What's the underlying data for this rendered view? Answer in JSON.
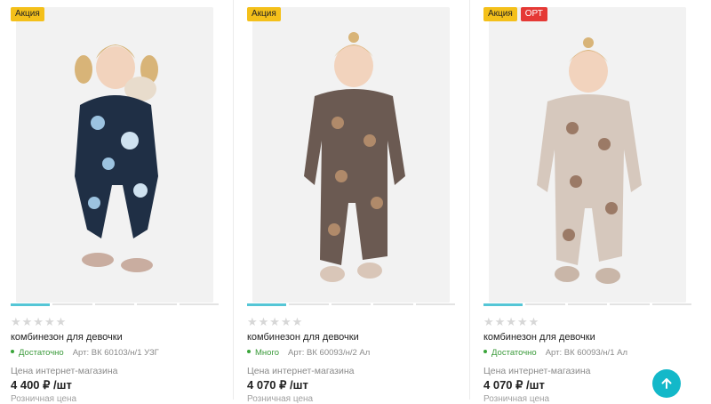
{
  "products": [
    {
      "badges": [
        {
          "label": "Акция",
          "kind": "sale"
        }
      ],
      "rating_stars": "★★★★★",
      "title": "комбинезон для девочки",
      "stock": "Достаточно",
      "article": "Арт: ВК 60103/н/1 УЗГ",
      "price_label": "Цена интернет-магазина",
      "price": "4 400 ₽ /шт",
      "cutoff_text": "Розничная цена"
    },
    {
      "badges": [
        {
          "label": "Акция",
          "kind": "sale"
        }
      ],
      "rating_stars": "★★★★★",
      "title": "комбинезон для девочки",
      "stock": "Много",
      "article": "Арт: ВК 60093/н/2 Ал",
      "price_label": "Цена интернет-магазина",
      "price": "4 070 ₽ /шт",
      "cutoff_text": "Розничная цена"
    },
    {
      "badges": [
        {
          "label": "Акция",
          "kind": "sale"
        },
        {
          "label": "ОРТ",
          "kind": "opt"
        }
      ],
      "rating_stars": "★★★★★",
      "title": "комбинезон для девочки",
      "stock": "Достаточно",
      "article": "Арт: ВК 60093/н/1 Ал",
      "price_label": "Цена интернет-магазина",
      "price": "4 070 ₽ /шт",
      "cutoff_text": "Розничная цена"
    }
  ],
  "icons": {
    "scroll_top": "arrow-up-icon",
    "rating": "star-icon"
  },
  "colors": {
    "sale_badge": "#f4c01a",
    "opt_badge": "#e53935",
    "accent": "#13b8c9",
    "stock_green": "#3a9a3a"
  }
}
